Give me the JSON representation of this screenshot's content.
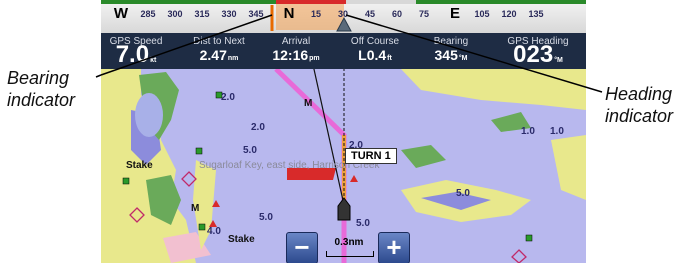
{
  "compass": {
    "ticks": [
      {
        "text": "W",
        "big": true
      },
      {
        "text": "285"
      },
      {
        "text": "300"
      },
      {
        "text": "315"
      },
      {
        "text": "330"
      },
      {
        "text": "345"
      },
      {
        "text": "N",
        "big": true
      },
      {
        "text": "15"
      },
      {
        "text": "30"
      },
      {
        "text": "45"
      },
      {
        "text": "60"
      },
      {
        "text": "75"
      },
      {
        "text": "E",
        "big": true
      },
      {
        "text": "105"
      },
      {
        "text": "120"
      },
      {
        "text": "135"
      }
    ]
  },
  "fields": [
    {
      "label": "GPS Speed",
      "value": "7.0",
      "unit": "kt",
      "xl": true
    },
    {
      "label": "Dist to Next",
      "value": "2.47",
      "unit": "nm"
    },
    {
      "label": "Arrival",
      "value": "12:16",
      "unit": "pm"
    },
    {
      "label": "Off Course",
      "value": "L0.4",
      "unit": "ft"
    },
    {
      "label": "Bearing",
      "value": "345",
      "unit": "°M"
    },
    {
      "label": "GPS Heading",
      "value": "023",
      "unit": "°M",
      "xl": true
    }
  ],
  "callouts": {
    "bearing_line1": "Bearing",
    "bearing_line2": "indicator",
    "heading_line1": "Heading",
    "heading_line2": "indicator"
  },
  "map": {
    "turn_label": "TURN 1",
    "depths": [
      "2.0",
      "2.0",
      "5.0",
      "5.0",
      "5.0",
      "2.0",
      "1.0",
      "1.0",
      "5.0",
      "4.0"
    ],
    "place_labels": [
      "Stake",
      "Stake",
      "M",
      "M"
    ],
    "area_label": "Sugarloaf Key, east side, Harrison Creek"
  },
  "zoom": {
    "minus": "−",
    "plus": "+",
    "scale": "0.3nm"
  },
  "colors": {
    "water": "#b8b8ee",
    "land": "#e8e88c",
    "shallow": "#8c8cdc",
    "route": "#e86ad8",
    "track": "#f0a040",
    "marsh": "#6aaa5a",
    "bar": "#1e2c44"
  }
}
